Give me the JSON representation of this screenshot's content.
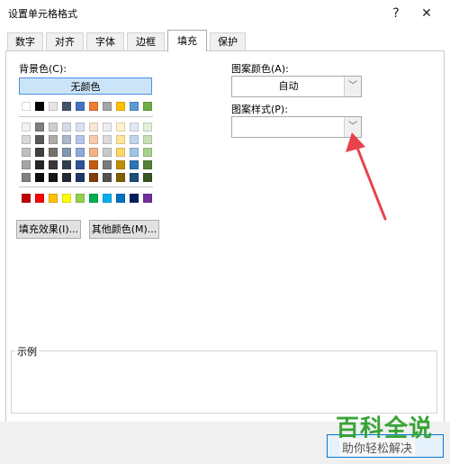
{
  "dialog": {
    "title": "设置单元格格式",
    "help_glyph": "?",
    "close_glyph": "✕"
  },
  "tabs": [
    {
      "label": "数字"
    },
    {
      "label": "对齐"
    },
    {
      "label": "字体"
    },
    {
      "label": "边框"
    },
    {
      "label": "填充"
    },
    {
      "label": "保护"
    }
  ],
  "active_tab": "填充",
  "background": {
    "label": "背景色(C):",
    "no_color_label": "无颜色",
    "fill_effects_label": "填充效果(I)...",
    "more_colors_label": "其他颜色(M)..."
  },
  "palette": {
    "top_row": [
      "#ffffff",
      "#000000",
      "#e7e6e6",
      "#44546a",
      "#4472c4",
      "#ed7d31",
      "#a5a5a5",
      "#ffc000",
      "#5b9bd5",
      "#70ad47"
    ],
    "tint_rows": [
      [
        "#f2f2f2",
        "#7f7f7f",
        "#d0cece",
        "#d6dce4",
        "#d9e2f3",
        "#fbe5d6",
        "#ededed",
        "#fff2cc",
        "#deebf6",
        "#e2efd9"
      ],
      [
        "#d9d9d9",
        "#595959",
        "#aeabab",
        "#adb9ca",
        "#b4c6e7",
        "#f8cbad",
        "#dbdbdb",
        "#ffe699",
        "#bdd7ee",
        "#c5e0b3"
      ],
      [
        "#bfbfbf",
        "#404040",
        "#767171",
        "#8496b0",
        "#8eaadb",
        "#f4b183",
        "#c9c9c9",
        "#ffd966",
        "#9dc3e6",
        "#a8d08d"
      ],
      [
        "#a6a6a6",
        "#262626",
        "#3a3838",
        "#333f4f",
        "#2f5496",
        "#c55a11",
        "#7b7b7b",
        "#bf9000",
        "#2e75b6",
        "#538135"
      ],
      [
        "#808080",
        "#0d0d0d",
        "#171616",
        "#222a35",
        "#1f3864",
        "#833c0b",
        "#525252",
        "#7f6000",
        "#1f4e79",
        "#375623"
      ]
    ],
    "standard_row": [
      "#c00000",
      "#ff0000",
      "#ffc000",
      "#ffff00",
      "#92d050",
      "#00b050",
      "#00b0f0",
      "#0070c0",
      "#002060",
      "#7030a0"
    ]
  },
  "pattern_color": {
    "label": "图案颜色(A):",
    "value": "自动"
  },
  "pattern_style": {
    "label": "图案样式(P):",
    "value": ""
  },
  "sample": {
    "label": "示例"
  },
  "watermark": {
    "title": "百科全说",
    "subtitle": "助你轻松解决"
  },
  "colors": {
    "annotation_arrow": "#e8434a",
    "selected_fill": "#cce4f7",
    "selected_border": "#4a90e2"
  }
}
